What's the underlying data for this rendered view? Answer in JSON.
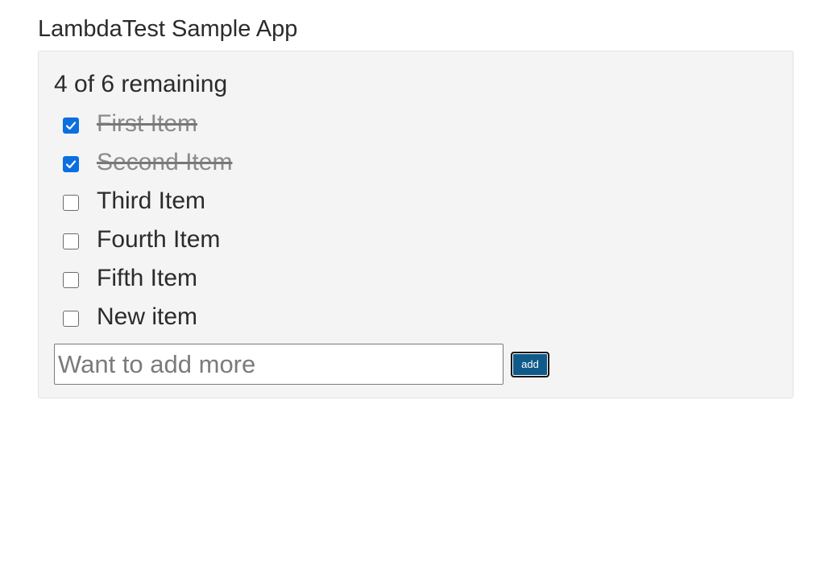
{
  "app": {
    "title": "LambdaTest Sample App"
  },
  "summary": {
    "remaining_text": "4 of 6 remaining",
    "remaining": 4,
    "total": 6
  },
  "todos": [
    {
      "label": "First Item",
      "checked": true
    },
    {
      "label": "Second Item",
      "checked": true
    },
    {
      "label": "Third Item",
      "checked": false
    },
    {
      "label": "Fourth Item",
      "checked": false
    },
    {
      "label": "Fifth Item",
      "checked": false
    },
    {
      "label": "New item",
      "checked": false
    }
  ],
  "add_form": {
    "placeholder": "Want to add more",
    "value": "",
    "button_label": "add"
  },
  "colors": {
    "checkbox_checked": "#0b6fe0",
    "button_bg": "#0f5a8a",
    "panel_bg": "#f4f4f4",
    "done_text": "#8a8a8a"
  },
  "icons": {
    "check": "check-icon"
  }
}
